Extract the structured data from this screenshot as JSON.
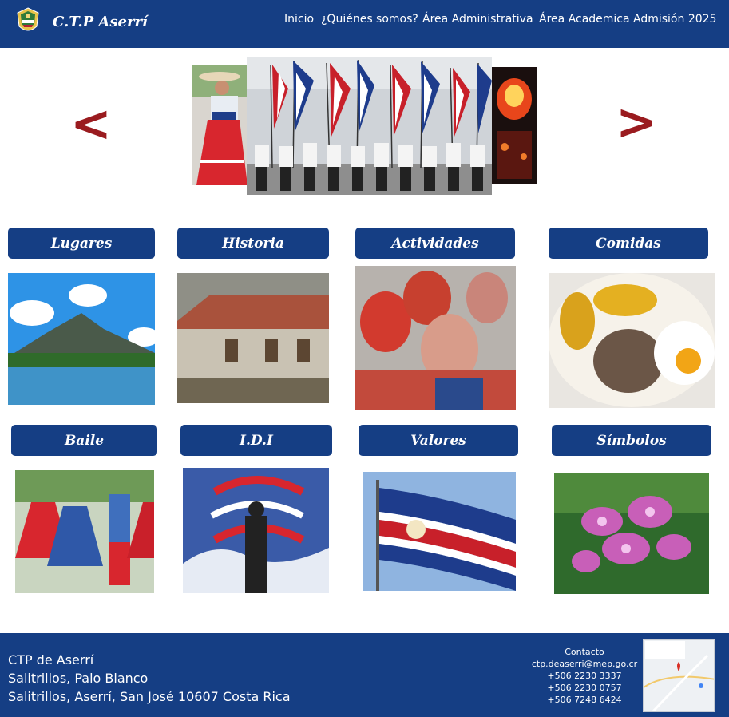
{
  "header": {
    "brand": "C.T.P Aserrí",
    "nav": [
      "Inicio",
      "¿Quiénes somos?",
      "Área Administrativa",
      "Área Academica",
      "Admisión 2025"
    ]
  },
  "carousel": {
    "prev_icon": "<",
    "next_icon": ">"
  },
  "categories": [
    {
      "label": "Lugares",
      "image": "volcano-lake-photo"
    },
    {
      "label": "Historia",
      "image": "old-adobe-house-photo"
    },
    {
      "label": "Actividades",
      "image": "mascarada-masks-photo"
    },
    {
      "label": "Comidas",
      "image": "gallo-pinto-plate-photo"
    },
    {
      "label": "Baile",
      "image": "folk-dance-photo"
    },
    {
      "label": "I.D.I",
      "image": "flag-ribbon-illustration"
    },
    {
      "label": "Valores",
      "image": "costa-rica-flag-photo"
    },
    {
      "label": "Símbolos",
      "image": "guaria-morada-orchid-photo"
    }
  ],
  "footer": {
    "address": [
      "CTP de Aserrí",
      "Salitrillos, Palo Blanco",
      "Salitrillos, Aserrí, San José 10607 Costa Rica"
    ],
    "contact_title": "Contacto",
    "email": "ctp.deaserri@mep.go.cr",
    "phones": [
      "+506 2230 3337",
      "+506 2230 0757",
      "+506 7248 6424"
    ]
  },
  "colors": {
    "primary": "#153e84",
    "arrow": "#9a1b1f",
    "background": "#ffffff"
  }
}
